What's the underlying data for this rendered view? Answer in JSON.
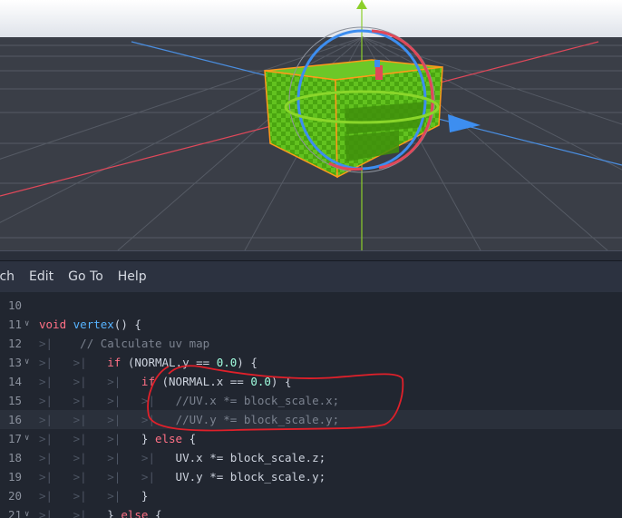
{
  "menu": {
    "items": [
      "rch",
      "Edit",
      "Go To",
      "Help"
    ]
  },
  "editor": {
    "lines": [
      {
        "num": "10",
        "fold": "",
        "html": ""
      },
      {
        "num": "11",
        "fold": "v",
        "html": "<span class=\"kw\">void</span> <span class=\"fn\">vertex</span>() {"
      },
      {
        "num": "12",
        "fold": "",
        "html": "<span class=\"tabmark\">&gt;|</span>    <span class=\"cm\">// Calculate uv map</span>"
      },
      {
        "num": "13",
        "fold": "v",
        "html": "<span class=\"tabmark\">&gt;|</span>   <span class=\"tabmark\">&gt;|</span>   <span class=\"kw\">if</span> (NORMAL.y == <span class=\"num\">0.0</span>) {"
      },
      {
        "num": "14",
        "fold": "",
        "html": "<span class=\"tabmark\">&gt;|</span>   <span class=\"tabmark\">&gt;|</span>   <span class=\"tabmark\">&gt;|</span>   <span class=\"kw\">if</span> (NORMAL.x == <span class=\"num\">0.0</span>) {"
      },
      {
        "num": "15",
        "fold": "",
        "html": "<span class=\"tabmark\">&gt;|</span>   <span class=\"tabmark\">&gt;|</span>   <span class=\"tabmark\">&gt;|</span>   <span class=\"tabmark\">&gt;|</span>   <span class=\"cm\">//UV.x *= block_scale.x;</span>"
      },
      {
        "num": "16",
        "fold": "",
        "html": "<span class=\"tabmark\">&gt;|</span>   <span class=\"tabmark\">&gt;|</span>   <span class=\"tabmark\">&gt;|</span>   <span class=\"tabmark\">&gt;|</span>   <span class=\"cm\">//UV.y *= block_scale.y;</span>"
      },
      {
        "num": "17",
        "fold": "v",
        "html": "<span class=\"tabmark\">&gt;|</span>   <span class=\"tabmark\">&gt;|</span>   <span class=\"tabmark\">&gt;|</span>   } <span class=\"kw\">else</span> {"
      },
      {
        "num": "18",
        "fold": "",
        "html": "<span class=\"tabmark\">&gt;|</span>   <span class=\"tabmark\">&gt;|</span>   <span class=\"tabmark\">&gt;|</span>   <span class=\"tabmark\">&gt;|</span>   UV.x *= block_scale.z;"
      },
      {
        "num": "19",
        "fold": "",
        "html": "<span class=\"tabmark\">&gt;|</span>   <span class=\"tabmark\">&gt;|</span>   <span class=\"tabmark\">&gt;|</span>   <span class=\"tabmark\">&gt;|</span>   UV.y *= block_scale.y;"
      },
      {
        "num": "20",
        "fold": "",
        "html": "<span class=\"tabmark\">&gt;|</span>   <span class=\"tabmark\">&gt;|</span>   <span class=\"tabmark\">&gt;|</span>   }"
      },
      {
        "num": "21",
        "fold": "v",
        "html": "<span class=\"tabmark\">&gt;|</span>   <span class=\"tabmark\">&gt;|</span>   } <span class=\"kw\">else</span> {"
      }
    ],
    "current_line": "16"
  },
  "colors": {
    "viewport_bg": "#3a3e47",
    "editor_bg": "#212630",
    "keyword": "#ff7085",
    "function": "#57b3ff",
    "number": "#a1ffe0",
    "comment": "#7b828f",
    "annotation": "#e0202a",
    "cube_green": "#56b81a",
    "selection_outline": "#ff9a1a"
  },
  "viewport": {
    "icons": [
      "gizmo-rotate-icon",
      "gizmo-move-arrow-icon"
    ]
  }
}
